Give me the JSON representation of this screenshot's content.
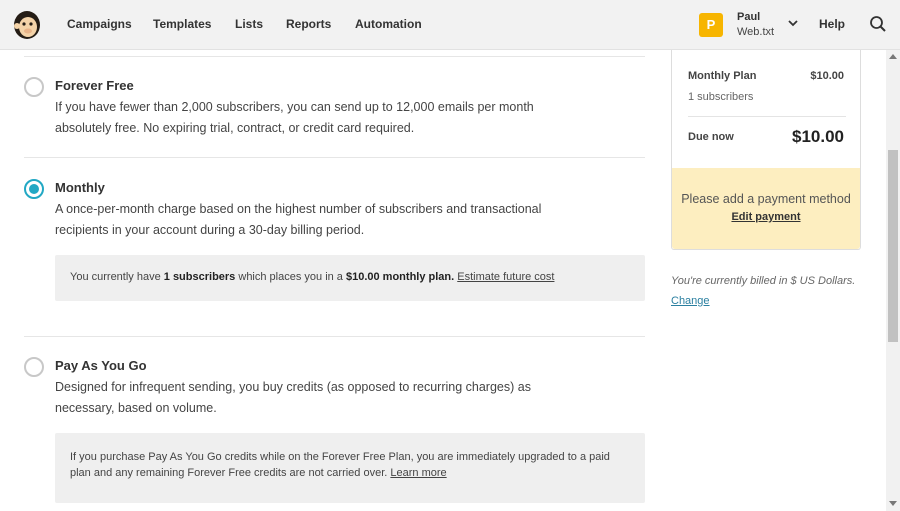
{
  "nav": {
    "items": [
      "Campaigns",
      "Templates",
      "Lists",
      "Reports",
      "Automation"
    ],
    "help": "Help",
    "user": {
      "initial": "P",
      "name": "Paul",
      "account": "Web.txt"
    }
  },
  "plans": [
    {
      "title": "Forever Free",
      "description": "If you have fewer than 2,000 subscribers, you can send up to 12,000 emails per month absolutely free. No expiring trial, contract, or credit card required.",
      "selected": false
    },
    {
      "title": "Monthly",
      "description": "A once-per-month charge based on the highest number of subscribers and transactional recipients in your account during a 30-day billing period.",
      "selected": true,
      "note": {
        "prefix": "You currently have ",
        "count": "1 subscribers",
        "middle": " which places you in a ",
        "plan": "$10.00 monthly plan.",
        "link": "Estimate future cost"
      }
    },
    {
      "title": "Pay As You Go",
      "description": "Designed for infrequent sending, you buy credits (as opposed to recurring charges) as necessary, based on volume.",
      "selected": false,
      "note": {
        "text": "If you purchase Pay As You Go credits while on the Forever Free Plan, you are immediately upgraded to a paid plan and any remaining Forever Free credits are not carried over.",
        "link": "Learn more"
      }
    }
  ],
  "summary": {
    "plan_label": "Monthly Plan",
    "plan_amount": "$10.00",
    "subscribers": "1 subscribers",
    "due_label": "Due now",
    "due_amount": "$10.00",
    "payment_message": "Please add a payment method",
    "payment_link": "Edit payment",
    "billed_note": "You're currently billed in $ US Dollars.",
    "change_link": "Change"
  },
  "colors": {
    "accent": "#22a8c4",
    "avatar": "#f7b500",
    "payment_bg": "#fdeec0"
  }
}
